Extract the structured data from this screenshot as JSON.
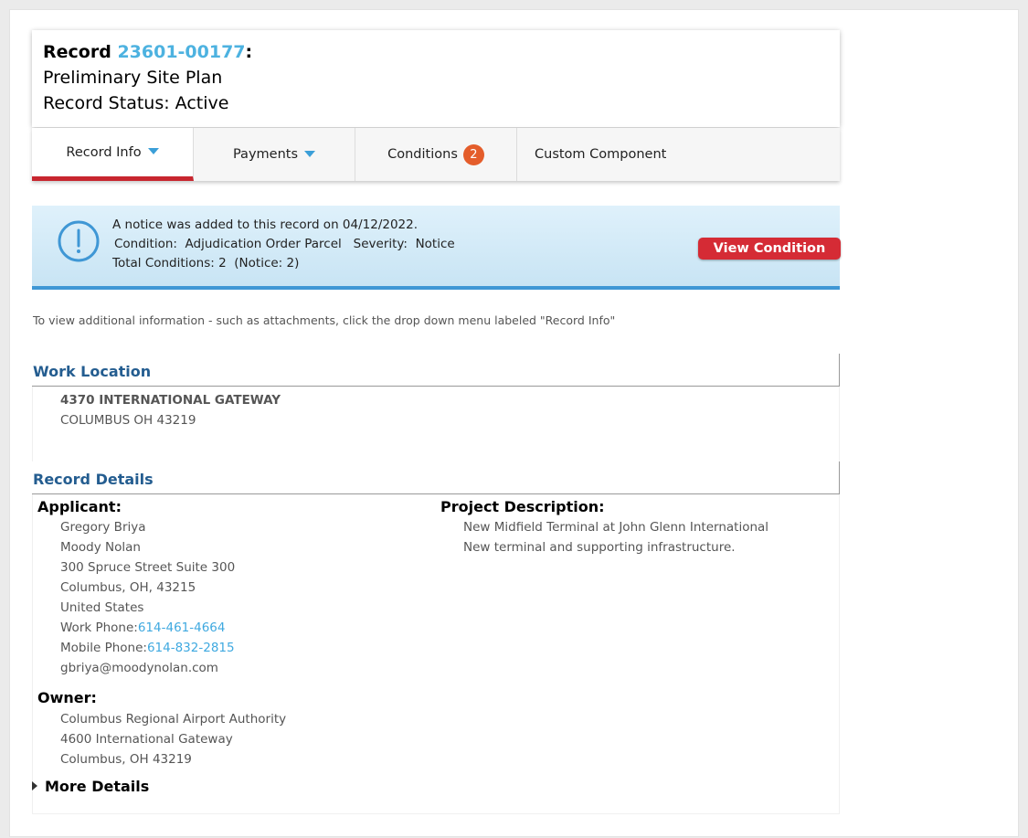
{
  "header": {
    "record_prefix": "Record",
    "record_number": "23601-00177",
    "record_suffix": ":",
    "record_type": "Preliminary Site Plan",
    "record_status": "Record Status: Active"
  },
  "tabs": [
    {
      "label": "Record Info",
      "has_dropdown": true,
      "active": true
    },
    {
      "label": "Payments",
      "has_dropdown": true,
      "active": false
    },
    {
      "label": "Conditions",
      "badge": "2",
      "active": false
    },
    {
      "label": "Custom Component",
      "active": false
    }
  ],
  "notice": {
    "icon": "exclamation-circle-icon",
    "line1": "A notice was added to this record on 04/12/2022.",
    "line2": "Condition:  Adjudication Order Parcel   Severity:  Notice",
    "line3": "Total Conditions: 2  (Notice: 2)",
    "button_label": "View Condition"
  },
  "info_text": "To view additional information - such as attachments, click the drop down menu labeled \"Record Info\"",
  "work_location": {
    "title": "Work Location",
    "address_line1": "4370 INTERNATIONAL GATEWAY",
    "address_line2": "COLUMBUS OH 43219"
  },
  "record_details": {
    "title": "Record Details",
    "applicant": {
      "label": "Applicant:",
      "name": "Gregory Briya",
      "company": "Moody Nolan",
      "street": "300 Spruce Street Suite 300",
      "city": "Columbus, OH, 43215",
      "country": "United States",
      "work_phone_label": "Work Phone:",
      "work_phone": "614-461-4664",
      "mobile_phone_label": "Mobile Phone:",
      "mobile_phone": "614-832-2815",
      "email": "gbriya@moodynolan.com"
    },
    "project_description": {
      "label": "Project Description:",
      "line1": "New Midfield Terminal at John Glenn International",
      "line2": "New terminal and supporting infrastructure."
    },
    "owner": {
      "label": "Owner:",
      "name": "Columbus Regional Airport Authority",
      "street": "4600 International Gateway",
      "city": "Columbus, OH 43219"
    },
    "more_details": "More Details"
  },
  "colors": {
    "accent_blue": "#4db2e0",
    "section_title": "#245d90",
    "active_tab_underline": "#c8262f",
    "badge": "#e45d2b",
    "button_red": "#d52b35",
    "notice_border": "#3f97d5"
  }
}
